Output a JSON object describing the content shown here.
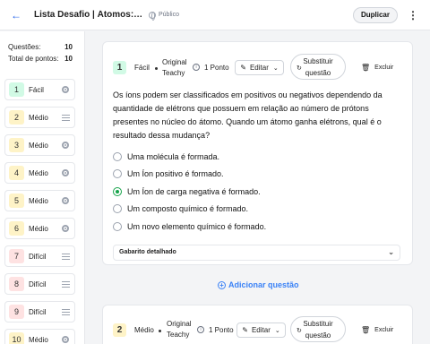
{
  "header": {
    "back_icon": "arrow-left-icon",
    "title": "Lista Desafio | Átomos: Intr...",
    "visibility": "Público",
    "duplicate_label": "Duplicar",
    "more_icon": "more-vertical-icon"
  },
  "sidebar": {
    "questions_label": "Questões:",
    "questions_count": "10",
    "points_label": "Total de pontos:",
    "points_count": "10",
    "items": [
      {
        "num": "1",
        "level": "Fácil",
        "color": "#d1fae5",
        "icon": "radio-icon"
      },
      {
        "num": "2",
        "level": "Médio",
        "color": "#fef3c7",
        "icon": "text-lines-icon"
      },
      {
        "num": "3",
        "level": "Médio",
        "color": "#fef3c7",
        "icon": "radio-icon"
      },
      {
        "num": "4",
        "level": "Médio",
        "color": "#fef3c7",
        "icon": "radio-icon"
      },
      {
        "num": "5",
        "level": "Médio",
        "color": "#fef3c7",
        "icon": "radio-icon"
      },
      {
        "num": "6",
        "level": "Médio",
        "color": "#fef3c7",
        "icon": "radio-icon"
      },
      {
        "num": "7",
        "level": "Difícil",
        "color": "#fee2e2",
        "icon": "text-lines-icon"
      },
      {
        "num": "8",
        "level": "Difícil",
        "color": "#fee2e2",
        "icon": "text-lines-icon"
      },
      {
        "num": "9",
        "level": "Difícil",
        "color": "#fee2e2",
        "icon": "text-lines-icon"
      },
      {
        "num": "10",
        "level": "Médio",
        "color": "#fef3c7",
        "icon": "radio-icon"
      }
    ]
  },
  "question1": {
    "num": "1",
    "level": "Fácil",
    "source_line1": "Original",
    "source_line2": "Teachy",
    "points": "1 Ponto",
    "edit_label": "Editar",
    "replace_line1": "Substituir",
    "replace_line2": "questão",
    "delete_label": "Excluir",
    "prompt": "Os íons podem ser classificados em positivos ou negativos dependendo da quantidade de elétrons que possuem em relação ao número de prótons presentes no núcleo do átomo. Quando um átomo ganha elétrons, qual é o resultado dessa mudança?",
    "options": [
      {
        "text": "Uma molécula é formada.",
        "selected": false
      },
      {
        "text": "Um Íon positivo é formado.",
        "selected": false
      },
      {
        "text": "Um Íon de carga negativa é formado.",
        "selected": true
      },
      {
        "text": "Um composto químico é formado.",
        "selected": false
      },
      {
        "text": "Um novo elemento químico é formado.",
        "selected": false
      }
    ],
    "answer_key_label": "Gabarito detalhado"
  },
  "add_question_label": "Adicionar questão",
  "question2": {
    "num": "2",
    "level": "Médio",
    "source_line1": "Original",
    "source_line2": "Teachy",
    "points": "1 Ponto",
    "edit_label": "Editar",
    "replace_line1": "Substituir",
    "replace_line2": "questão",
    "delete_label": "Excluir"
  },
  "colors": {
    "accent": "#3b82f6",
    "correct": "#16a34a",
    "easy": "#d1fae5",
    "medium": "#fef3c7",
    "hard": "#fee2e2"
  }
}
